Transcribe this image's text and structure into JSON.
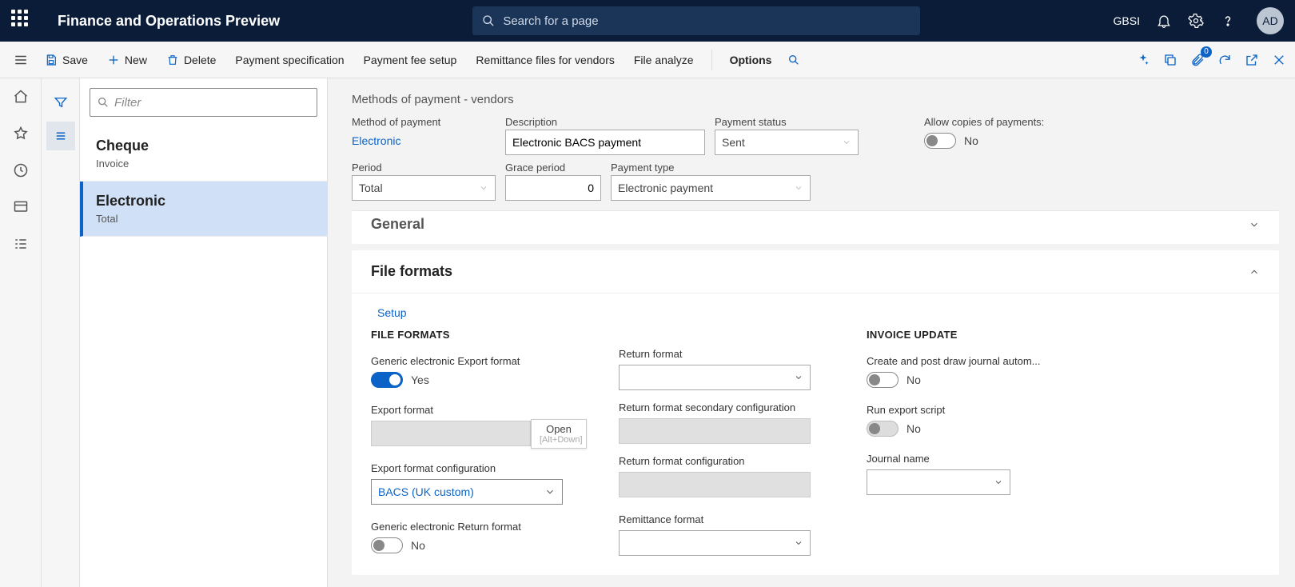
{
  "header": {
    "app_title": "Finance and Operations Preview",
    "search_placeholder": "Search for a page",
    "company": "GBSI",
    "avatar": "AD"
  },
  "cmdbar": {
    "save": "Save",
    "new": "New",
    "delete": "Delete",
    "payment_spec": "Payment specification",
    "payment_fee": "Payment fee setup",
    "remittance": "Remittance files for vendors",
    "file_analyze": "File analyze",
    "options": "Options",
    "badge": "0"
  },
  "list": {
    "filter_placeholder": "Filter",
    "items": [
      {
        "title": "Cheque",
        "sub": "Invoice"
      },
      {
        "title": "Electronic",
        "sub": "Total"
      }
    ]
  },
  "content": {
    "breadcrumb": "Methods of payment - vendors",
    "labels": {
      "method": "Method of payment",
      "description": "Description",
      "payment_status": "Payment status",
      "allow_copies": "Allow copies of payments:",
      "period": "Period",
      "grace": "Grace period",
      "payment_type": "Payment type"
    },
    "values": {
      "method": "Electronic",
      "description": "Electronic BACS payment",
      "payment_status": "Sent",
      "allow_copies": "No",
      "period": "Total",
      "grace": "0",
      "payment_type": "Electronic payment"
    },
    "sections": {
      "general": "General",
      "file_formats": "File formats"
    },
    "ff": {
      "setup": "Setup",
      "col1_head": "FILE FORMATS",
      "generic_export": "Generic electronic Export format",
      "generic_export_val": "Yes",
      "export_format": "Export format",
      "export_format_cfg": "Export format configuration",
      "export_format_cfg_val": "BACS (UK custom)",
      "generic_return": "Generic electronic Return format",
      "generic_return_val": "No",
      "return_format": "Return format",
      "return_sec_cfg": "Return format secondary configuration",
      "return_cfg": "Return format configuration",
      "remittance_format": "Remittance format",
      "col3_head": "INVOICE UPDATE",
      "create_post": "Create and post draw journal autom...",
      "create_post_val": "No",
      "run_export": "Run export script",
      "run_export_val": "No",
      "journal_name": "Journal name",
      "tooltip_open": "Open",
      "tooltip_alt": "[Alt+Down]"
    }
  }
}
